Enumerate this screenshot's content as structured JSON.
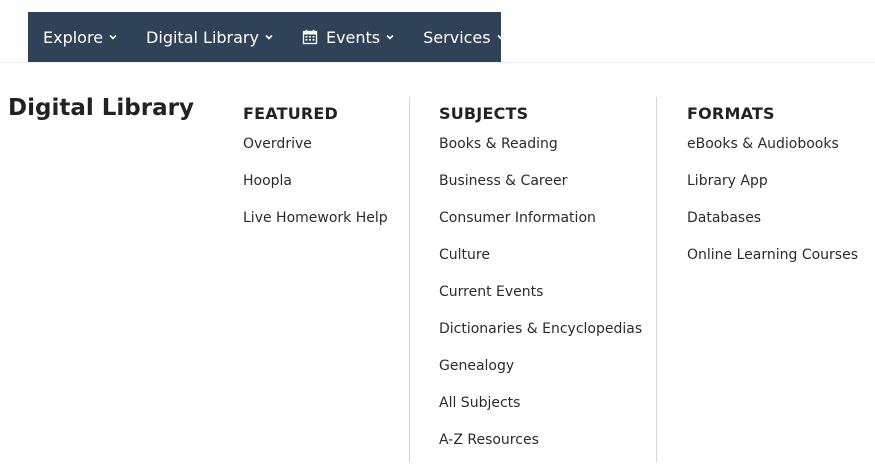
{
  "nav": {
    "explore": "Explore",
    "digital_library": "Digital Library",
    "events": "Events",
    "services": "Services"
  },
  "icons": {
    "chevron": "chevron-down-icon",
    "calendar": "calendar-icon"
  },
  "colors": {
    "navbar_bg": "#2f4257",
    "nav_text": "#ffffff",
    "divider": "#d0d4d8"
  },
  "page": {
    "heading": "Digital Library"
  },
  "featured": {
    "title": "FEATURED",
    "links": [
      "Overdrive",
      "Hoopla",
      "Live Homework Help"
    ]
  },
  "subjects": {
    "title": "SUBJECTS",
    "links": [
      "Books & Reading",
      "Business & Career",
      "Consumer Information",
      "Culture",
      "Current Events",
      "Dictionaries & Encyclopedias",
      "Genealogy",
      "All Subjects",
      "A-Z Resources"
    ]
  },
  "formats": {
    "title": "FORMATS",
    "links": [
      "eBooks & Audiobooks",
      "Library App",
      "Databases",
      "Online Learning Courses"
    ]
  }
}
